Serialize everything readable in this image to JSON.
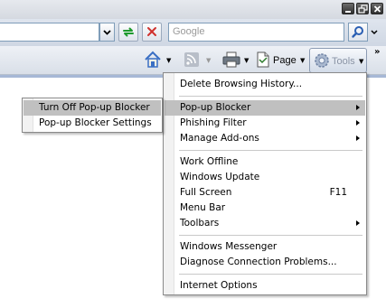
{
  "window": {
    "minimize_icon": "minimize-icon",
    "restore_icon": "restore-icon",
    "close_icon": "close-icon"
  },
  "address_bar": {
    "value": "",
    "search_placeholder": "Google"
  },
  "command_bar": {
    "page_label": "Page",
    "tools_label": "Tools"
  },
  "tools_menu": {
    "items": [
      {
        "label": "Delete Browsing History..."
      },
      {
        "label": "Pop-up Blocker",
        "submenu": true,
        "highlighted": true
      },
      {
        "label": "Phishing Filter",
        "submenu": true
      },
      {
        "label": "Manage Add-ons",
        "submenu": true
      },
      {
        "label": "Work Offline"
      },
      {
        "label": "Windows Update"
      },
      {
        "label": "Full Screen",
        "shortcut": "F11"
      },
      {
        "label": "Menu Bar"
      },
      {
        "label": "Toolbars",
        "submenu": true
      },
      {
        "label": "Windows Messenger"
      },
      {
        "label": "Diagnose Connection Problems..."
      },
      {
        "label": "Internet Options"
      }
    ]
  },
  "popup_submenu": {
    "items": [
      {
        "label": "Turn Off Pop-up Blocker",
        "highlighted": true
      },
      {
        "label": "Pop-up Blocker Settings"
      }
    ]
  },
  "colors": {
    "highlight": "#c0c0c0",
    "toolbar_blue": "#a6b8d6"
  }
}
